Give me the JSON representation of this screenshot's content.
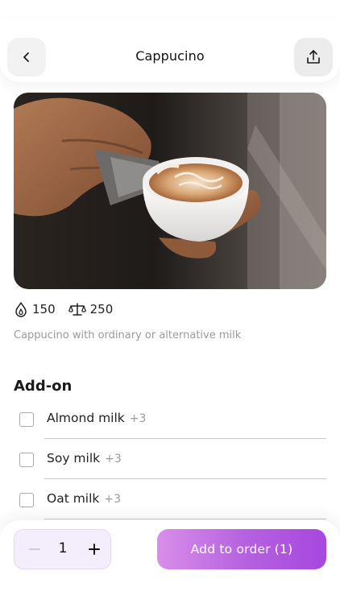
{
  "header": {
    "title": "Cappucino",
    "back_icon": "chevron-left-icon",
    "share_icon": "share-upload-icon"
  },
  "product": {
    "image": "cappuccino-latte-art-photo",
    "calories": "150",
    "calories_icon": "flame-drop-icon",
    "weight": "250",
    "weight_icon": "scale-icon",
    "description": "Cappucino with ordinary or alternative milk"
  },
  "addons": {
    "title": "Add-on",
    "items": [
      {
        "name": "Almond milk",
        "price": "+3",
        "checked": false
      },
      {
        "name": "Soy milk",
        "price": "+3",
        "checked": false
      },
      {
        "name": "Oat milk",
        "price": "+3",
        "checked": false
      }
    ]
  },
  "order": {
    "quantity": "1",
    "minus_label": "−",
    "plus_label": "+",
    "button_label": "Add to order",
    "button_count": "(1)"
  },
  "colors": {
    "accent_start": "#d88ee9",
    "accent_end": "#a748e0",
    "stepper_bg": "#f4eefc"
  }
}
